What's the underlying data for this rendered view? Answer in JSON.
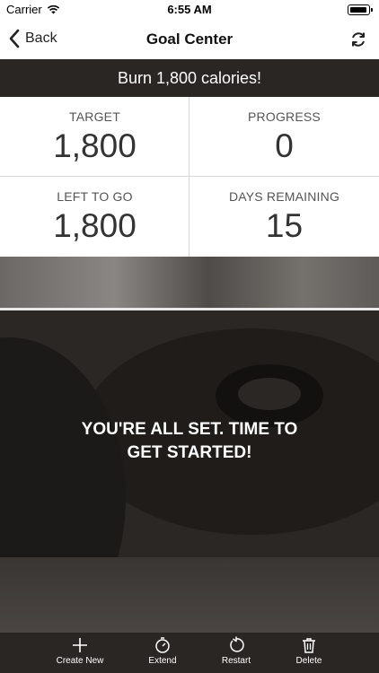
{
  "status_bar": {
    "carrier": "Carrier",
    "time": "6:55 AM"
  },
  "nav": {
    "back_label": "Back",
    "title": "Goal Center"
  },
  "banner": {
    "text": "Burn 1,800 calories!"
  },
  "stats": {
    "target": {
      "label": "TARGET",
      "value": "1,800"
    },
    "progress": {
      "label": "PROGRESS",
      "value": "0"
    },
    "left_to_go": {
      "label": "LEFT TO GO",
      "value": "1,800"
    },
    "days_remaining": {
      "label": "DAYS REMAINING",
      "value": "15"
    }
  },
  "message": "YOU'RE ALL SET. TIME TO GET STARTED!",
  "tabs": [
    {
      "label": "Create New",
      "icon": "plus-icon"
    },
    {
      "label": "Extend",
      "icon": "timer-icon"
    },
    {
      "label": "Restart",
      "icon": "restart-icon"
    },
    {
      "label": "Delete",
      "icon": "trash-icon"
    }
  ],
  "colors": {
    "bar_bg": "#2a2623",
    "text": "#333333"
  }
}
